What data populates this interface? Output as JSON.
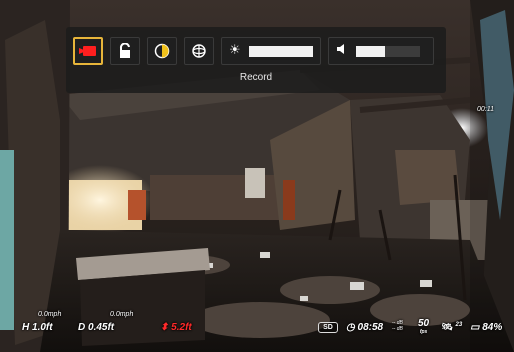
{
  "toolbar": {
    "label": "Record",
    "buttons": [
      {
        "name": "record-mode-icon",
        "active": true
      },
      {
        "name": "unlock-icon",
        "active": false
      },
      {
        "name": "contrast-icon",
        "active": false
      },
      {
        "name": "gimbal-icon",
        "active": false
      }
    ],
    "brightness": {
      "icon": "sun-icon",
      "level": 1.0
    },
    "volume": {
      "icon": "speaker-icon",
      "level": 0.45
    },
    "accent_color": "#e7b53a",
    "record_color": "#ff1f1f"
  },
  "hud": {
    "timestamp": "00:11",
    "height_label": "H",
    "height_value": "1.0ft",
    "depth_label": "D",
    "depth_value": "0.45ft",
    "distance_top_left": "0.0mph",
    "speed_top": "0.0mph",
    "warning_value": "5.2ft",
    "mode_badge": "SD",
    "clock": "08:58",
    "signal_top": "-- dB",
    "signal_bottom": "-- dB",
    "fps": "50",
    "fps_unit": "fps",
    "satellites": "23",
    "battery": "84%",
    "warning_color": "#ff2a2a"
  }
}
